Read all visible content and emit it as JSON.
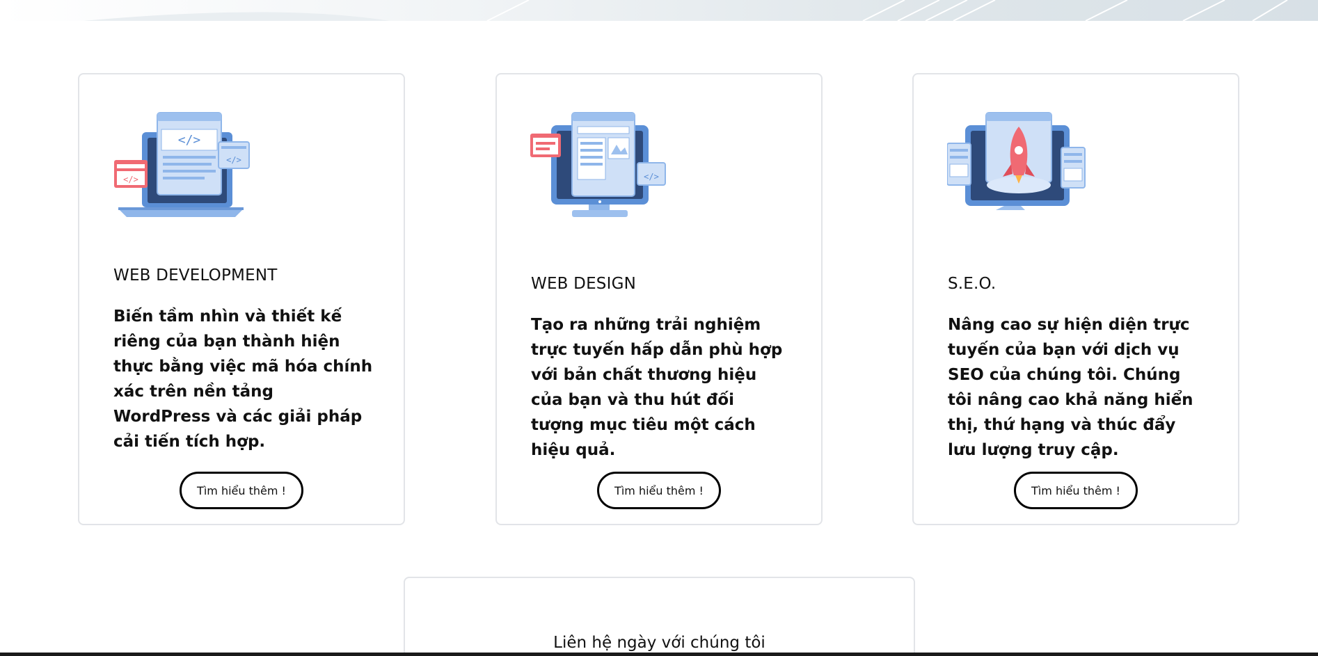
{
  "services": [
    {
      "icon": "web-development-laptop-code-icon",
      "title": "WEB DEVELOPMENT",
      "description": "Biến tầm nhìn và thiết kế riêng của bạn thành hiện thực bằng việc mã hóa chính xác trên nền tảng WordPress và các giải pháp cải tiến tích hợp.",
      "button": "Tìm hiểu thêm !"
    },
    {
      "icon": "web-design-monitor-layout-icon",
      "title": "WEB DESIGN",
      "description": "Tạo ra những trải nghiệm trực tuyến hấp dẫn phù hợp với bản chất thương hiệu của bạn và thu hút đối tượng mục tiêu một cách hiệu quả.",
      "button": "Tìm hiểu thêm !"
    },
    {
      "icon": "seo-monitor-rocket-icon",
      "title": "S.E.O.",
      "description": "Nâng cao sự hiện diện trực tuyến của bạn với dịch vụ SEO của chúng tôi. Chúng tôi nâng cao khả năng hiển thị, thứ hạng và thúc đẩy lưu lượng truy cập.",
      "button": "Tìm hiểu thêm !"
    }
  ],
  "contact": {
    "text": "Liên hệ ngày với chúng tôi"
  },
  "colors": {
    "card_border": "#e2e4e8",
    "button_border": "#000000",
    "icon_blue": "#5b8fd6",
    "icon_red": "#f06a73"
  }
}
